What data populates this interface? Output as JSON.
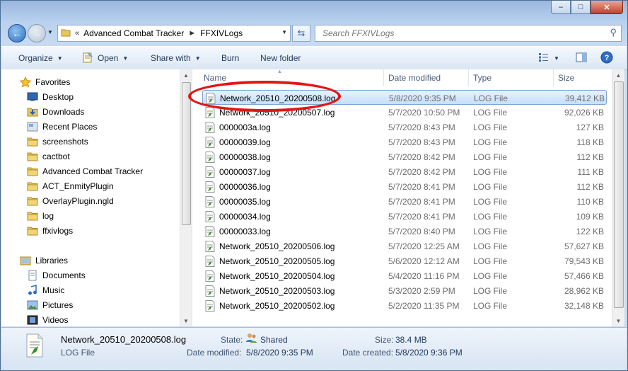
{
  "window": {
    "caption_buttons": {
      "minimize": "–",
      "maximize": "□",
      "close": "✕"
    }
  },
  "address": {
    "overflow": "«",
    "crumbs": [
      "Advanced Combat Tracker",
      "FFXIVLogs"
    ],
    "separator": "►"
  },
  "search": {
    "placeholder": "Search FFXIVLogs"
  },
  "toolbar": {
    "organize": "Organize",
    "open": "Open",
    "share_with": "Share with",
    "burn": "Burn",
    "new_folder": "New folder"
  },
  "nav": {
    "favorites_label": "Favorites",
    "favorites": [
      {
        "label": "Desktop",
        "icon": "desktop-icon"
      },
      {
        "label": "Downloads",
        "icon": "downloads-folder-icon"
      },
      {
        "label": "Recent Places",
        "icon": "recent-places-icon"
      },
      {
        "label": "screenshots",
        "icon": "folder-icon"
      },
      {
        "label": "cactbot",
        "icon": "folder-icon"
      },
      {
        "label": "Advanced Combat Tracker",
        "icon": "folder-icon"
      },
      {
        "label": "ACT_EnmityPlugin",
        "icon": "folder-icon"
      },
      {
        "label": "OverlayPlugin.ngld",
        "icon": "folder-icon"
      },
      {
        "label": "log",
        "icon": "folder-icon"
      },
      {
        "label": "ffxivlogs",
        "icon": "folder-icon"
      }
    ],
    "libraries_label": "Libraries",
    "libraries": [
      {
        "label": "Documents",
        "icon": "documents-icon"
      },
      {
        "label": "Music",
        "icon": "music-icon"
      },
      {
        "label": "Pictures",
        "icon": "pictures-icon"
      },
      {
        "label": "Videos",
        "icon": "videos-icon"
      }
    ]
  },
  "columns": {
    "name": "Name",
    "date": "Date modified",
    "type": "Type",
    "size": "Size"
  },
  "files": [
    {
      "name": "Network_20510_20200508.log",
      "date": "5/8/2020 9:35 PM",
      "type": "LOG File",
      "size": "39,412 KB",
      "selected": true
    },
    {
      "name": "Network_20510_20200507.log",
      "date": "5/7/2020 10:50 PM",
      "type": "LOG File",
      "size": "92,026 KB"
    },
    {
      "name": "0000003a.log",
      "date": "5/7/2020 8:43 PM",
      "type": "LOG File",
      "size": "127 KB"
    },
    {
      "name": "00000039.log",
      "date": "5/7/2020 8:43 PM",
      "type": "LOG File",
      "size": "118 KB"
    },
    {
      "name": "00000038.log",
      "date": "5/7/2020 8:42 PM",
      "type": "LOG File",
      "size": "112 KB"
    },
    {
      "name": "00000037.log",
      "date": "5/7/2020 8:42 PM",
      "type": "LOG File",
      "size": "111 KB"
    },
    {
      "name": "00000036.log",
      "date": "5/7/2020 8:41 PM",
      "type": "LOG File",
      "size": "112 KB"
    },
    {
      "name": "00000035.log",
      "date": "5/7/2020 8:41 PM",
      "type": "LOG File",
      "size": "110 KB"
    },
    {
      "name": "00000034.log",
      "date": "5/7/2020 8:41 PM",
      "type": "LOG File",
      "size": "109 KB"
    },
    {
      "name": "00000033.log",
      "date": "5/7/2020 8:40 PM",
      "type": "LOG File",
      "size": "122 KB"
    },
    {
      "name": "Network_20510_20200506.log",
      "date": "5/7/2020 12:25 AM",
      "type": "LOG File",
      "size": "57,627 KB"
    },
    {
      "name": "Network_20510_20200505.log",
      "date": "5/6/2020 12:12 AM",
      "type": "LOG File",
      "size": "79,543 KB"
    },
    {
      "name": "Network_20510_20200504.log",
      "date": "5/4/2020 11:16 PM",
      "type": "LOG File",
      "size": "57,466 KB"
    },
    {
      "name": "Network_20510_20200503.log",
      "date": "5/3/2020 2:59 PM",
      "type": "LOG File",
      "size": "28,962 KB"
    },
    {
      "name": "Network_20510_20200502.log",
      "date": "5/2/2020 11:35 PM",
      "type": "LOG File",
      "size": "32,148 KB"
    }
  ],
  "details": {
    "filename": "Network_20510_20200508.log",
    "filetype": "LOG File",
    "state_label": "State:",
    "state_value": "Shared",
    "size_label": "Size:",
    "size_value": "38.4 MB",
    "modified_label": "Date modified:",
    "modified_value": "5/8/2020 9:35 PM",
    "created_label": "Date created:",
    "created_value": "5/8/2020 9:36 PM"
  },
  "colors": {
    "highlight_ellipse": "#e21616",
    "selection": "#c4e0fc"
  }
}
